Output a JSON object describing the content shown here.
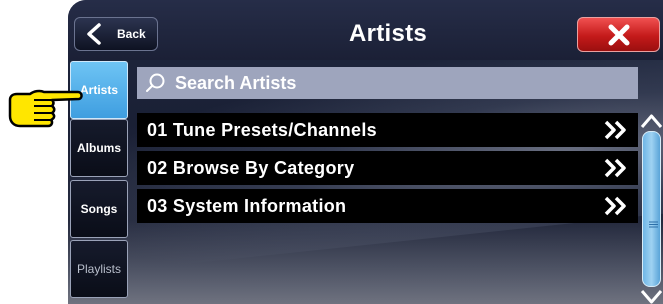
{
  "header": {
    "back_label": "Back",
    "title": "Artists",
    "close_icon": "close-x-icon"
  },
  "tabs": [
    {
      "label": "Artists",
      "active": true
    },
    {
      "label": "Albums",
      "active": false
    },
    {
      "label": "Songs",
      "active": false
    },
    {
      "label": "Playlists",
      "active": false
    }
  ],
  "search": {
    "placeholder": "Search Artists",
    "icon": "search-icon"
  },
  "menu": {
    "items": [
      {
        "label": "01 Tune Presets/Channels"
      },
      {
        "label": "02 Browse By Category"
      },
      {
        "label": "03 System Information"
      }
    ],
    "arrow_icon": "double-chevron-right-icon"
  },
  "pointer_icon": "pointing-hand-icon",
  "colors": {
    "accent_blue": "#4aa8e8",
    "close_red": "#d42323",
    "search_bg": "#9ea5bd",
    "pointer_yellow": "#ffe600"
  }
}
